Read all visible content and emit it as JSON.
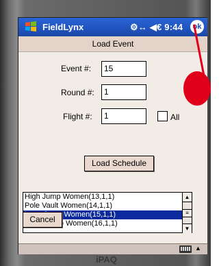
{
  "titlebar": {
    "app_name": "FieldLynx",
    "status": "⚙↔ ◀€ 9:44",
    "ok_label": "ok"
  },
  "caption": "Load Event",
  "form": {
    "event_label": "Event #:",
    "event_value": "15",
    "round_label": "Round #:",
    "round_value": "1",
    "flight_label": "Flight #:",
    "flight_value": "1",
    "all_label": "All",
    "all_checked": false
  },
  "buttons": {
    "load_schedule": "Load Schedule",
    "cancel": "Cancel"
  },
  "schedule_list": {
    "items": [
      "High Jump Women(13,1,1)",
      "Pole Vault Women(14,1,1)",
      "Long Jump Women(15,1,1)",
      "Triple Jump Women(16,1,1)"
    ],
    "selected_index": 2
  },
  "device": {
    "brand": "iPAQ"
  },
  "colors": {
    "titlebar": "#2256c2",
    "selection": "#0a2a9e",
    "annotation": "#e0001a"
  }
}
